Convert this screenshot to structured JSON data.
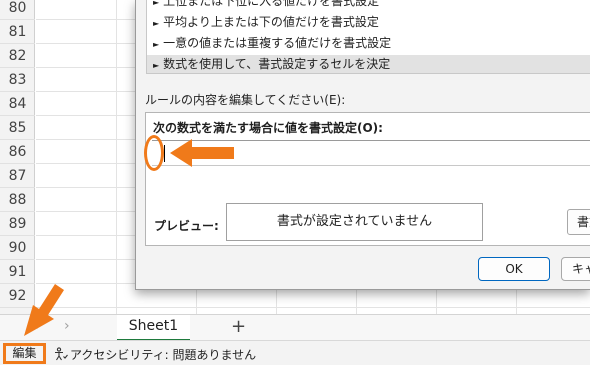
{
  "spreadsheet": {
    "row_numbers": [
      "80",
      "81",
      "82",
      "83",
      "84",
      "85",
      "86",
      "87",
      "88",
      "89",
      "90",
      "91",
      "92"
    ]
  },
  "dialog": {
    "rule_types": [
      "上位または下位に入る値だけを書式設定",
      "平均より上または下の値だけを書式設定",
      "一意の値または重複する値だけを書式設定",
      "数式を使用して、書式設定するセルを決定"
    ],
    "selected_rule_index": 3,
    "rule_description_label": "ルールの内容を編集してください(E):",
    "formula_label": "次の数式を満たす場合に値を書式設定(O):",
    "formula_value": "",
    "preview_label": "プレビュー:",
    "preview_text": "書式が設定されていません",
    "format_button": "書式",
    "ok_button": "OK",
    "cancel_button": "キャ"
  },
  "sheet_tabs": {
    "active": "Sheet1",
    "add": "+",
    "prev": "‹",
    "next": "›"
  },
  "status_bar": {
    "mode": "編集",
    "accessibility": "アクセシビリティ: 問題ありません"
  },
  "colors": {
    "annotation": "#f07a1a",
    "sheet_tab_accent": "#1e7a3d",
    "ok_border": "#0067c0"
  },
  "icons": {
    "rule_arrow": "right-triangle-arrow-icon",
    "accessibility": "accessibility-person-icon"
  }
}
